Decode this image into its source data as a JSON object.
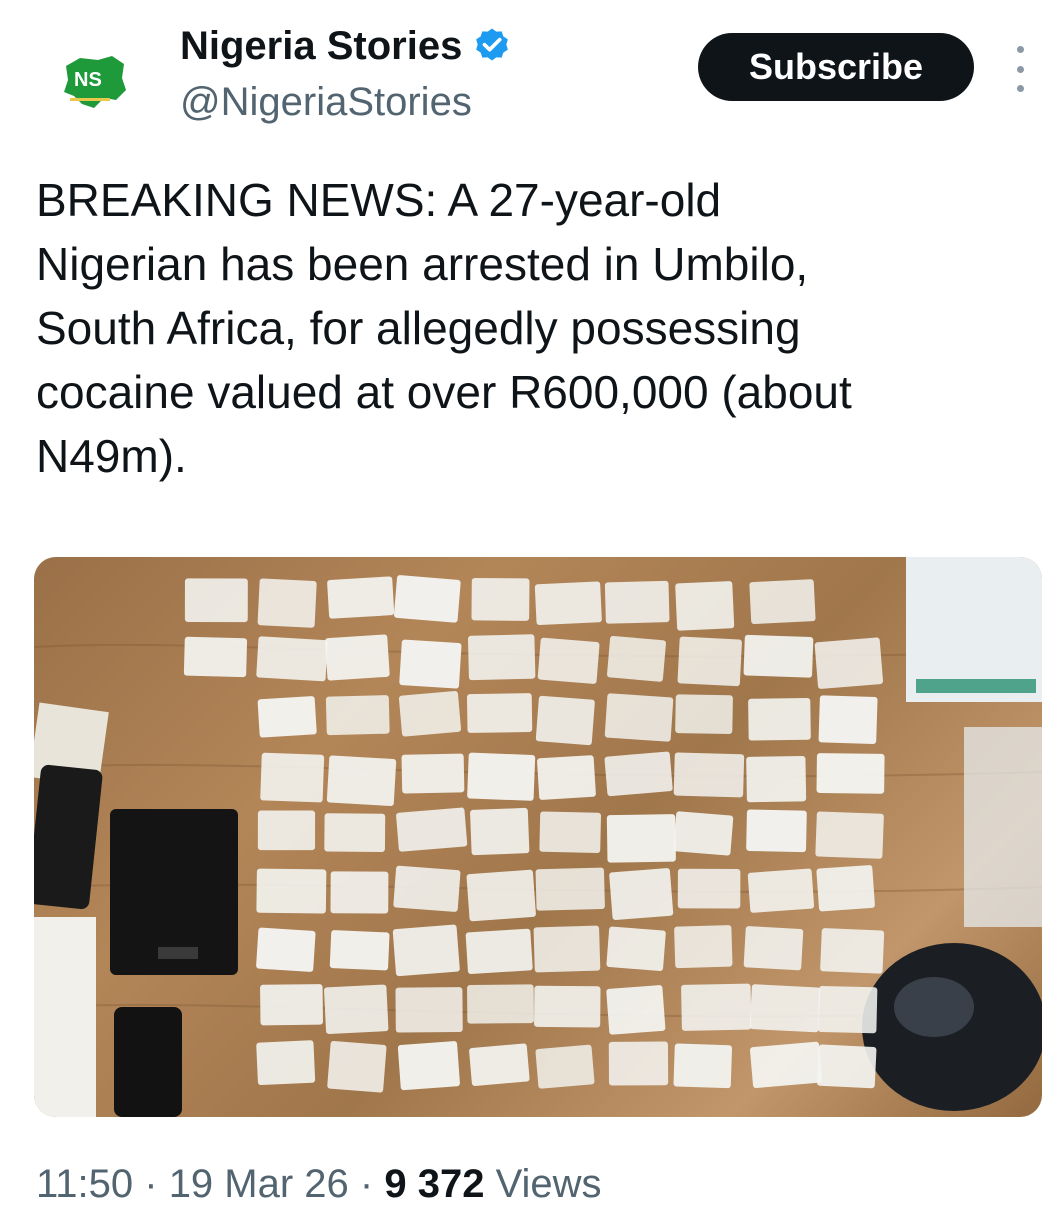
{
  "author": {
    "name": "Nigeria Stories",
    "handle": "@NigeriaStories",
    "avatar_icon": "nigeria-map-logo-icon",
    "verified_icon": "verified-badge-icon",
    "verified_color": "#1d9bf0",
    "logo_color": "#1f9a3a"
  },
  "actions": {
    "subscribe_label": "Subscribe",
    "more_icon": "more-vertical-icon"
  },
  "tweet": {
    "text": "BREAKING NEWS: A 27-year-old\nNigerian has been arrested in Umbilo,\nSouth Africa, for allegedly possessing\ncocaine valued at over R600,000 (about\nN49m).",
    "media_alt_icon": "photo-drug-packets-on-table"
  },
  "meta": {
    "time": "11:50",
    "separator": " · ",
    "date": "19 Mar 26",
    "views_count": "9 372",
    "views_label": " Views"
  }
}
